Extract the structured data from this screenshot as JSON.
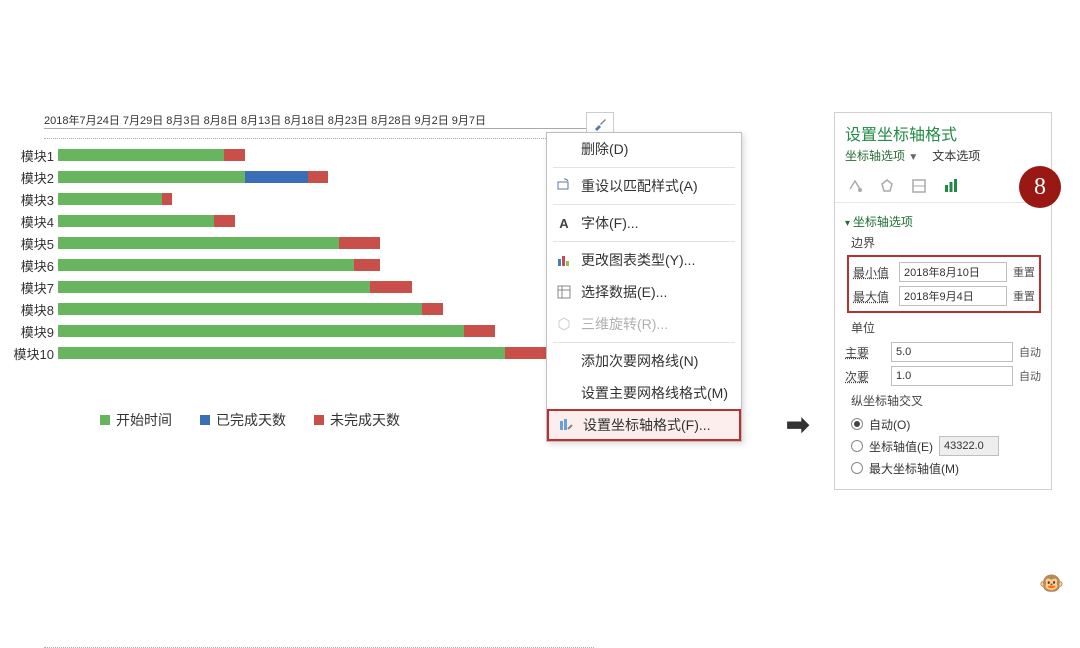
{
  "chart_data": {
    "type": "bar",
    "orientation": "horizontal-stacked",
    "categories": [
      "模块1",
      "模块2",
      "模块3",
      "模块4",
      "模块5",
      "模块6",
      "模块7",
      "模块8",
      "模块9",
      "模块10"
    ],
    "x_tick_labels": "2018年7月24日 7月29日 8月3日 8月8日 8月13日 8月18日 8月23日 8月28日 9月2日 9月7日",
    "series": [
      {
        "name": "开始时间",
        "color": "#68b560",
        "values": [
          32,
          36,
          20,
          30,
          54,
          57,
          60,
          70,
          78,
          86
        ]
      },
      {
        "name": "已完成天数",
        "color": "#3a6fb7",
        "values": [
          0,
          12,
          0,
          0,
          0,
          0,
          0,
          0,
          0,
          0
        ]
      },
      {
        "name": "未完成天数",
        "color": "#c94f4a",
        "values": [
          4,
          4,
          2,
          4,
          8,
          5,
          8,
          4,
          6,
          8
        ]
      }
    ]
  },
  "legend": {
    "start": "开始时间",
    "done": "已完成天数",
    "todo": "未完成天数"
  },
  "chart_tool": {
    "brush": "brush-icon"
  },
  "context_menu": {
    "delete": "删除(D)",
    "reset_match_style": "重设以匹配样式(A)",
    "font": "字体(F)...",
    "change_chart_type": "更改图表类型(Y)...",
    "select_data": "选择数据(E)...",
    "rotate_3d": "三维旋转(R)...",
    "add_minor_grid": "添加次要网格线(N)",
    "major_grid_format": "设置主要网格线格式(M)",
    "format_axis": "设置坐标轴格式(F)..."
  },
  "panel": {
    "title": "设置坐标轴格式",
    "tab_axis_options": "坐标轴选项",
    "tab_text_options": "文本选项",
    "section_axis_options": "坐标轴选项",
    "bounds_label": "边界",
    "min_label": "最小值",
    "min_value": "2018年8月10日",
    "max_label": "最大值",
    "max_value": "2018年9月4日",
    "reset": "重置",
    "units_label": "单位",
    "major_label": "主要",
    "major_value": "5.0",
    "minor_label": "次要",
    "minor_value": "1.0",
    "auto": "自动",
    "cross_label": "纵坐标轴交叉",
    "cross_auto": "自动(O)",
    "cross_value": "坐标轴值(E)",
    "cross_value_val": "43322.0",
    "cross_max": "最大坐标轴值(M)"
  },
  "step_badge": "8"
}
